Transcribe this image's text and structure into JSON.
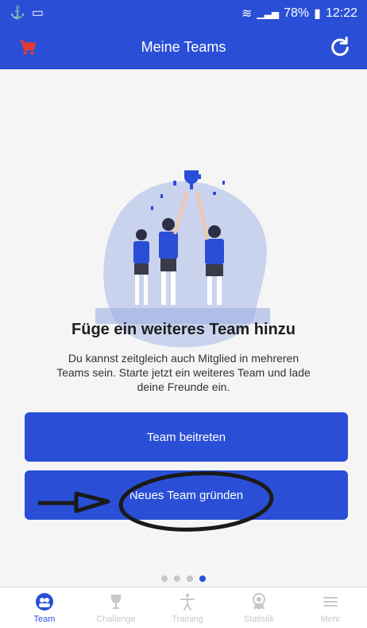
{
  "status_bar": {
    "battery_percent": "78%",
    "time": "12:22"
  },
  "app_bar": {
    "title": "Meine Teams",
    "left_icon": "cart-icon",
    "right_icon": "refresh-icon"
  },
  "hero": {
    "headline": "Füge ein weiteres Team hinzu",
    "description": "Du kannst zeitgleich auch Mitglied in mehreren Teams sein. Starte jetzt ein weiteres Team und lade deine Freunde ein."
  },
  "buttons": {
    "join_label": "Team beitreten",
    "create_label": "Neues Team gründen"
  },
  "pagination": {
    "count": 4,
    "active_index": 3
  },
  "bottom_nav": [
    {
      "label": "Team",
      "icon": "team-icon",
      "active": true
    },
    {
      "label": "Challenge",
      "icon": "trophy-icon",
      "active": false
    },
    {
      "label": "Training",
      "icon": "training-icon",
      "active": false
    },
    {
      "label": "Statistik",
      "icon": "statistics-icon",
      "active": false
    },
    {
      "label": "Mehr",
      "icon": "menu-icon",
      "active": false
    }
  ],
  "colors": {
    "primary": "#2a4fd6",
    "cart": "#e53935",
    "background": "#f5f5f5",
    "inactive_nav": "#c8c8c8"
  }
}
